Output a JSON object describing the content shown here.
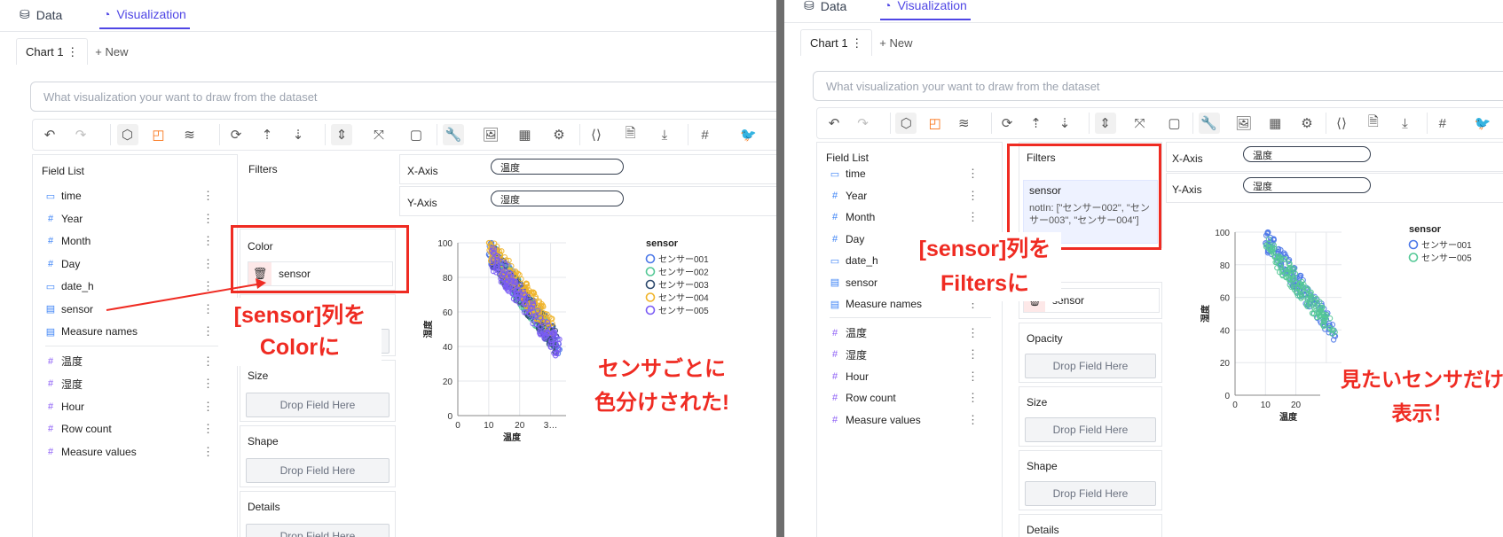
{
  "nav": {
    "data_tab": "Data",
    "viz_tab": "Visualization"
  },
  "charts": {
    "tab": "Chart 1",
    "new": "+ New"
  },
  "prompt": {
    "placeholder": "What visualization your want to draw from the dataset"
  },
  "icons": [
    "undo-icon",
    "redo-icon",
    "cube-icon",
    "mark-icon",
    "layers-icon",
    "refresh-icon",
    "sort-asc-icon",
    "sort-desc-icon",
    "stepper-icon",
    "scale-icon",
    "canvas-icon",
    "wrench-icon",
    "image-icon",
    "table-icon",
    "gear-icon",
    "code-icon",
    "file-icon",
    "download-icon",
    "hash-icon",
    "bird-icon"
  ],
  "left": {
    "field_list_title": "Field List",
    "dimensions": [
      {
        "type": "date",
        "name": "time"
      },
      {
        "type": "num",
        "name": "Year"
      },
      {
        "type": "num",
        "name": "Month"
      },
      {
        "type": "num",
        "name": "Day"
      },
      {
        "type": "date",
        "name": "date_h"
      },
      {
        "type": "text",
        "name": "sensor"
      },
      {
        "type": "text",
        "name": "Measure names"
      }
    ],
    "measures": [
      "温度",
      "湿度",
      "Hour",
      "Row count",
      "Measure values"
    ],
    "filters_title": "Filters",
    "color_title": "Color",
    "color_field": "sensor",
    "size_title": "Size",
    "shape_title": "Shape",
    "details_title": "Details",
    "drop_label": "Drop Field Here",
    "x_axis_label": "X-Axis",
    "y_axis_label": "Y-Axis",
    "x_field": "温度",
    "y_field": "湿度",
    "annotation1": "[sensor]列を",
    "annotation2": "Colorに",
    "annotation3": "センサごとに",
    "annotation4": "色分けされた!"
  },
  "right": {
    "field_list_title": "Field List",
    "dimensions": [
      {
        "type": "date",
        "name": "time"
      },
      {
        "type": "num",
        "name": "Year"
      },
      {
        "type": "num",
        "name": "Month"
      },
      {
        "type": "num",
        "name": "Day"
      },
      {
        "type": "date",
        "name": "date_h"
      },
      {
        "type": "text",
        "name": "sensor"
      },
      {
        "type": "text",
        "name": "Measure names"
      }
    ],
    "measures": [
      "温度",
      "湿度",
      "Hour",
      "Row count",
      "Measure values"
    ],
    "filters_title": "Filters",
    "filter_field": "sensor",
    "filter_expr": "notIn: [\"センサー002\", \"センサー003\", \"センサー004\"]",
    "color_field": "sensor",
    "opacity_title": "Opacity",
    "size_title": "Size",
    "shape_title": "Shape",
    "details_title": "Details",
    "drop_label": "Drop Field Here",
    "x_axis_label": "X-Axis",
    "y_axis_label": "Y-Axis",
    "x_field": "温度",
    "y_field": "湿度",
    "annotation1": "[sensor]列を",
    "annotation2": "Filtersに",
    "annotation3": "見たいセンサだけ",
    "annotation4": "表示！"
  },
  "chart_data": [
    {
      "type": "scatter",
      "xlabel": "温度",
      "ylabel": "湿度",
      "xlim": [
        0,
        35
      ],
      "ylim": [
        0,
        100
      ],
      "x_ticks": [
        "0",
        "10",
        "20",
        "3…"
      ],
      "y_ticks": [
        "0",
        "20",
        "40",
        "60",
        "80",
        "100"
      ],
      "legend_title": "sensor",
      "legend_position": "right",
      "series": [
        {
          "name": "センサー001",
          "color": "#4c78e8",
          "x_range": [
            10,
            33
          ],
          "y_range": [
            40,
            96
          ]
        },
        {
          "name": "センサー002",
          "color": "#54c896",
          "x_range": [
            11,
            32
          ],
          "y_range": [
            42,
            93
          ]
        },
        {
          "name": "センサー003",
          "color": "#2e4a6e",
          "x_range": [
            11,
            32
          ],
          "y_range": [
            42,
            92
          ]
        },
        {
          "name": "センサー004",
          "color": "#f0b429",
          "x_range": [
            10,
            31
          ],
          "y_range": [
            50,
            98
          ]
        },
        {
          "name": "センサー005",
          "color": "#7b5cf5",
          "x_range": [
            10,
            33
          ],
          "y_range": [
            38,
            94
          ]
        }
      ]
    },
    {
      "type": "scatter",
      "xlabel": "温度",
      "ylabel": "湿度",
      "xlim": [
        0,
        35
      ],
      "ylim": [
        0,
        100
      ],
      "x_ticks": [
        "0",
        "10",
        "20"
      ],
      "y_ticks": [
        "0",
        "20",
        "40",
        "60",
        "80",
        "100"
      ],
      "legend_title": "sensor",
      "legend_position": "right",
      "series": [
        {
          "name": "センサー001",
          "color": "#4c78e8",
          "x_range": [
            10,
            33
          ],
          "y_range": [
            38,
            96
          ]
        },
        {
          "name": "センサー005",
          "color": "#54c896",
          "x_range": [
            10,
            33
          ],
          "y_range": [
            40,
            92
          ]
        }
      ]
    }
  ]
}
